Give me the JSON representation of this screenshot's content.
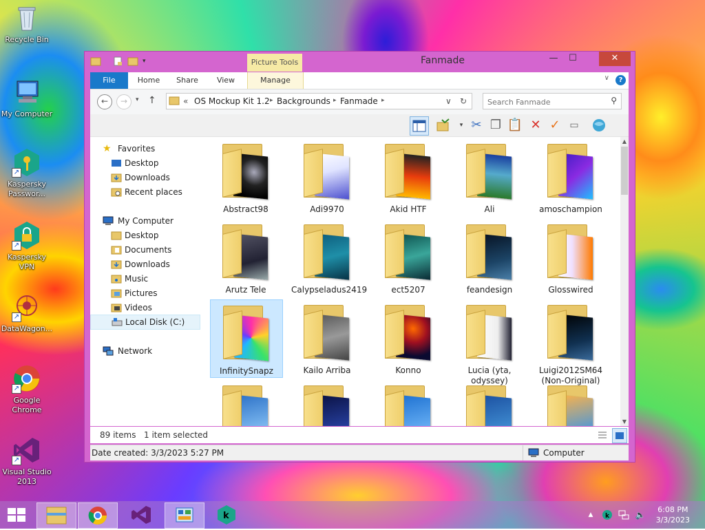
{
  "desktop": {
    "icons": [
      {
        "label": "Recycle Bin"
      },
      {
        "label": "My Computer"
      },
      {
        "label": "Kaspersky Passwor..."
      },
      {
        "label": "Kaspersky VPN"
      },
      {
        "label": "DataWagon..."
      },
      {
        "label": "Google Chrome"
      },
      {
        "label": "Visual Studio 2013"
      }
    ]
  },
  "window": {
    "title": "Fanmade",
    "contextual_tab_group": "Picture Tools",
    "ribbon_tabs": [
      "File",
      "Home",
      "Share",
      "View",
      "Manage"
    ],
    "help_label": "?",
    "address": {
      "prefix": "«",
      "crumbs": [
        "OS Mockup Kit 1.2",
        "Backgrounds",
        "Fanmade"
      ]
    },
    "search": {
      "placeholder": "Search Fanmade"
    },
    "nav": {
      "favorites_label": "Favorites",
      "favorites": [
        "Desktop",
        "Downloads",
        "Recent places"
      ],
      "computer_label": "My Computer",
      "computer": [
        "Desktop",
        "Documents",
        "Downloads",
        "Music",
        "Pictures",
        "Videos",
        "Local Disk (C:)"
      ],
      "network_label": "Network"
    },
    "files": [
      {
        "name": "Abstract98"
      },
      {
        "name": "Adi9970"
      },
      {
        "name": "Akid HTF"
      },
      {
        "name": "Ali"
      },
      {
        "name": "amoschampion"
      },
      {
        "name": "Arutz Tele"
      },
      {
        "name": "Calypseladus2419"
      },
      {
        "name": "ect5207"
      },
      {
        "name": "feandesign"
      },
      {
        "name": "Glosswired"
      },
      {
        "name": "InfinitySnapz"
      },
      {
        "name": "Kailo Arriba"
      },
      {
        "name": "Konno"
      },
      {
        "name": "Lucia (yta, odyssey)"
      },
      {
        "name": "Luigi2012SM64 (Non-Original)"
      }
    ],
    "status": {
      "item_count": "89 items",
      "selected": "1 item selected"
    },
    "details": {
      "date_created": "Date created: 3/3/2023 5:27 PM",
      "location": "Computer"
    }
  },
  "taskbar": {
    "time": "6:08 PM",
    "date": "3/3/2023"
  },
  "colors": {
    "window_frame": "#d465cf",
    "close_button": "#c7483b",
    "file_tab": "#1979ca",
    "selection": "#cce8ff",
    "folder": "#e8c76a"
  }
}
